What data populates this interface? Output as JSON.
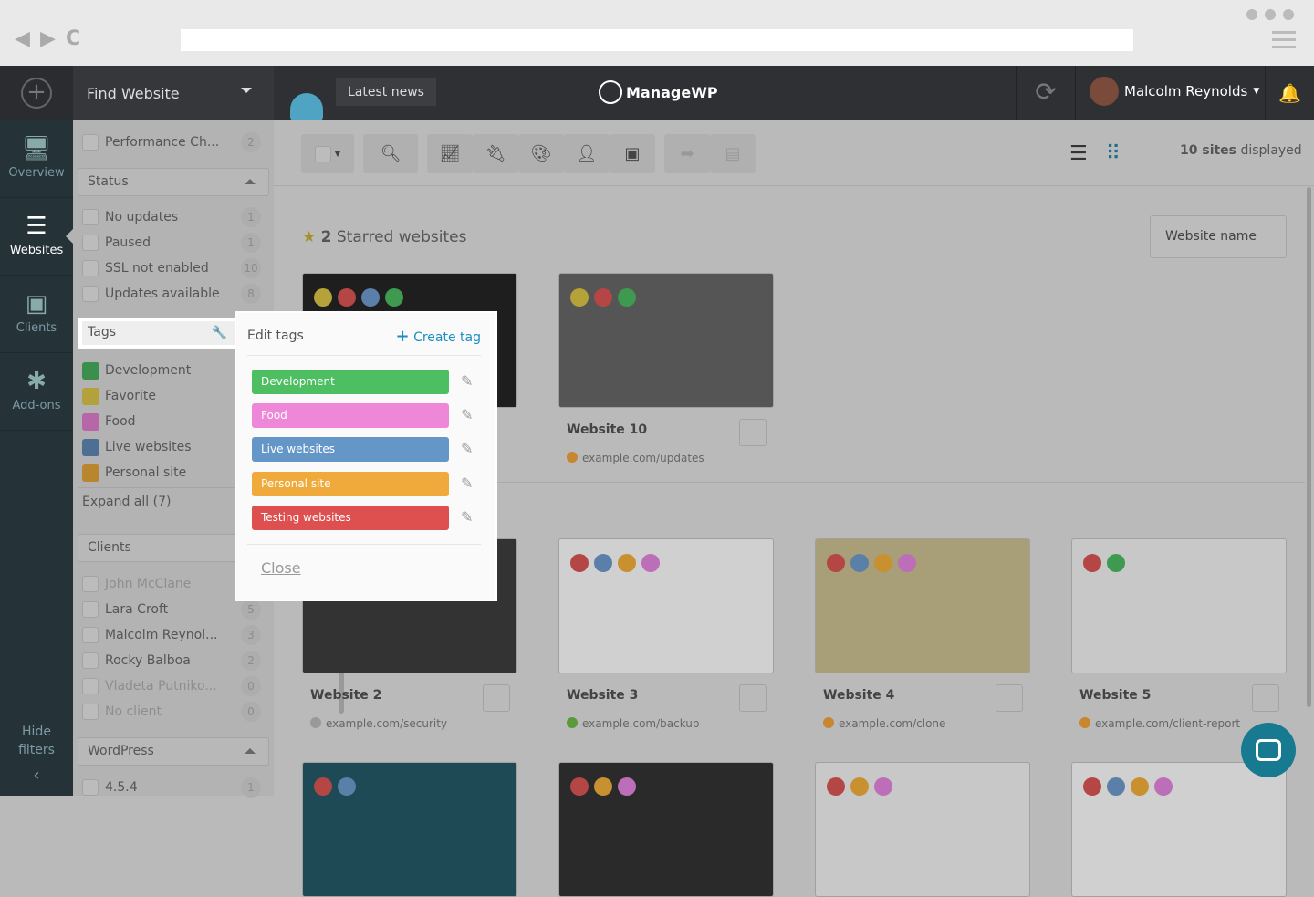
{
  "browser": {
    "back": "◀",
    "forward": "▶",
    "reload": "C"
  },
  "header": {
    "find_website": "Find Website",
    "latest_news": "Latest news",
    "logo": "ManageWP",
    "user": "Malcolm Reynolds"
  },
  "nav": [
    {
      "label": "Overview",
      "icon": "monitor-chart-icon",
      "glyph": "📈"
    },
    {
      "label": "Websites",
      "icon": "websites-list-icon",
      "glyph": "☰"
    },
    {
      "label": "Clients",
      "icon": "client-badge-icon",
      "glyph": "👤"
    },
    {
      "label": "Add-ons",
      "icon": "puzzle-gear-icon",
      "glyph": "✱"
    }
  ],
  "hide_filters": "Hide filters",
  "filters": {
    "performance": {
      "label": "Performance Ch...",
      "count": "2"
    },
    "status_title": "Status",
    "status": [
      {
        "label": "No updates",
        "count": "1"
      },
      {
        "label": "Paused",
        "count": "1"
      },
      {
        "label": "SSL not enabled",
        "count": "10"
      },
      {
        "label": "Updates available",
        "count": "8"
      }
    ],
    "tags_title": "Tags",
    "tags": [
      {
        "label": "Development",
        "color": "#3a8f4c"
      },
      {
        "label": "Favorite",
        "color": "#b3a23c"
      },
      {
        "label": "Food",
        "color": "#b567a8"
      },
      {
        "label": "Live websites",
        "color": "#4d6f93"
      },
      {
        "label": "Personal site",
        "color": "#b8862f"
      }
    ],
    "expand_all": "Expand all (7)",
    "clients_title": "Clients",
    "clients": [
      {
        "label": "John McClane",
        "count": "",
        "disabled": true
      },
      {
        "label": "Lara Croft",
        "count": "5"
      },
      {
        "label": "Malcolm Reynol...",
        "count": "3"
      },
      {
        "label": "Rocky Balboa",
        "count": "2"
      },
      {
        "label": "Vladeta Putniko...",
        "count": "0",
        "disabled": true
      },
      {
        "label": "No client",
        "count": "0",
        "disabled": true
      }
    ],
    "wordpress_title": "WordPress",
    "wordpress": [
      {
        "label": "4.5.4",
        "count": "1"
      }
    ]
  },
  "toolbar": {
    "sites_bold": "10 sites",
    "sites_rest": " displayed"
  },
  "starred": {
    "count": "2",
    "label": " Starred websites"
  },
  "sort": "Website name",
  "cards": [
    {
      "name": "",
      "url": "",
      "dots": [
        "#b5a33a",
        "#b54646",
        "#5a7fa8",
        "#3d9a4f"
      ],
      "thumb": "#1e1e1e"
    },
    {
      "name": "Website 10",
      "url": "example.com/updates",
      "globe": "#c8862f",
      "dots": [
        "#b5a33a",
        "#b54646",
        "#3d9a4f"
      ],
      "thumb": "#555"
    },
    {
      "name": "Website 2",
      "url": "example.com/security",
      "globe": "#999",
      "dots": [],
      "thumb": "#333"
    },
    {
      "name": "Website 3",
      "url": "example.com/backup",
      "globe": "#5a9a3a",
      "dots": [
        "#b54646",
        "#5a7fa8",
        "#c8902f",
        "#bd6eb8"
      ],
      "thumb": "#d0d0d0"
    },
    {
      "name": "Website 4",
      "url": "example.com/clone",
      "globe": "#c8862f",
      "dots": [
        "#b54646",
        "#5a7fa8",
        "#c8902f",
        "#bd6eb8"
      ],
      "thumb": "#a89e78"
    },
    {
      "name": "Website 5",
      "url": "example.com/client-report",
      "globe": "#c8862f",
      "dots": [
        "#b54646",
        "#3d9a4f"
      ],
      "thumb": "#c8c8c8"
    },
    {
      "name": "",
      "url": "",
      "dots": [
        "#b54646",
        "#5a7fa8"
      ],
      "thumb": "#1d4a55"
    },
    {
      "name": "",
      "url": "",
      "dots": [
        "#b54646",
        "#c8902f",
        "#bd6eb8"
      ],
      "thumb": "#2a2a2a"
    },
    {
      "name": "",
      "url": "",
      "dots": [
        "#b54646",
        "#c8902f",
        "#bd6eb8"
      ],
      "thumb": "#c8c8c8"
    },
    {
      "name": "",
      "url": "",
      "dots": [
        "#b54646",
        "#5a7fa8",
        "#c8902f",
        "#bd6eb8"
      ],
      "thumb": "#d0d0d0"
    }
  ],
  "popup": {
    "title": "Edit tags",
    "create": "Create tag",
    "close": "Close",
    "tags": [
      {
        "label": "Development",
        "color": "#4dbf62"
      },
      {
        "label": "Food",
        "color": "#ee87d8"
      },
      {
        "label": "Live websites",
        "color": "#6497c7"
      },
      {
        "label": "Personal site",
        "color": "#f0aa3c"
      },
      {
        "label": "Testing websites",
        "color": "#de5050"
      }
    ]
  }
}
